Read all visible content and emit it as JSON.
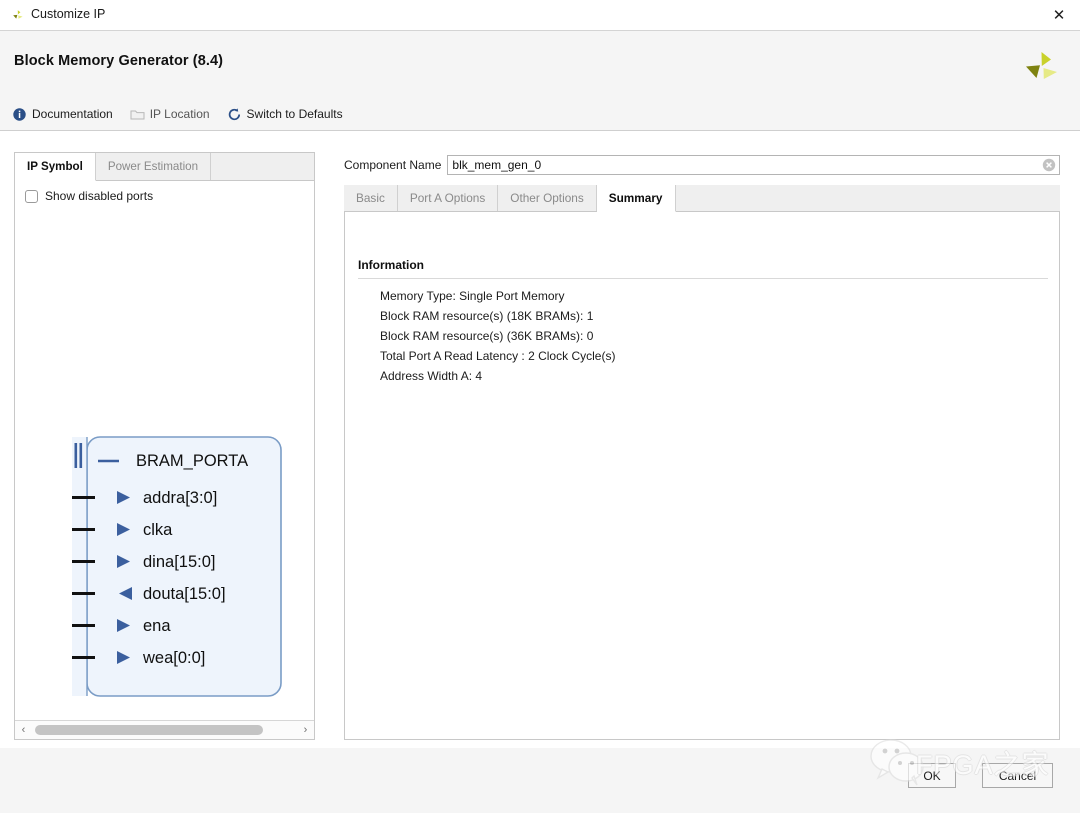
{
  "window": {
    "title": "Customize IP",
    "app_icon": "vivado-logo-icon",
    "close_label": "✕"
  },
  "header": {
    "title": "Block Memory Generator (8.4)",
    "logo": "xilinx-pinwheel-logo"
  },
  "toolbar": {
    "items": [
      {
        "label": "Documentation",
        "icon": "info-circle-icon",
        "enabled": true
      },
      {
        "label": "IP Location",
        "icon": "folder-icon",
        "enabled": false
      },
      {
        "label": "Switch to Defaults",
        "icon": "refresh-icon",
        "enabled": true
      }
    ]
  },
  "left_panel": {
    "tabs": [
      {
        "label": "IP Symbol",
        "active": true
      },
      {
        "label": "Power Estimation",
        "active": false
      }
    ],
    "show_disabled_ports": {
      "label": "Show disabled ports",
      "checked": false
    },
    "symbol": {
      "bus_label": "BRAM_PORTA",
      "ports": [
        {
          "name": "addra[3:0]",
          "direction": "input"
        },
        {
          "name": "clka",
          "direction": "input"
        },
        {
          "name": "dina[15:0]",
          "direction": "input"
        },
        {
          "name": "douta[15:0]",
          "direction": "output"
        },
        {
          "name": "ena",
          "direction": "input"
        },
        {
          "name": "wea[0:0]",
          "direction": "input"
        }
      ],
      "fill_color": "#eef4fc",
      "border_color": "#7a9cc6",
      "arrow_color": "#3b5f9e"
    },
    "scrollbar": {
      "left_arrow": "‹",
      "right_arrow": "›"
    }
  },
  "component_name": {
    "label": "Component Name",
    "value": "blk_mem_gen_0",
    "placeholder": "",
    "clear_icon": "clear-circle-icon"
  },
  "right_panel": {
    "tabs": [
      {
        "label": "Basic",
        "active": false
      },
      {
        "label": "Port A Options",
        "active": false
      },
      {
        "label": "Other Options",
        "active": false
      },
      {
        "label": "Summary",
        "active": true
      }
    ],
    "information": {
      "heading": "Information",
      "lines": [
        "Memory Type: Single Port Memory",
        "Block RAM resource(s) (18K BRAMs): 1",
        "Block RAM resource(s) (36K BRAMs): 0",
        "Total Port A Read Latency : 2 Clock Cycle(s)",
        "Address Width A: 4"
      ]
    }
  },
  "footer": {
    "ok_label": "OK",
    "cancel_label": "Cancel"
  },
  "watermark": {
    "text": "FPGA之家",
    "icon": "wechat-logo-icon"
  }
}
